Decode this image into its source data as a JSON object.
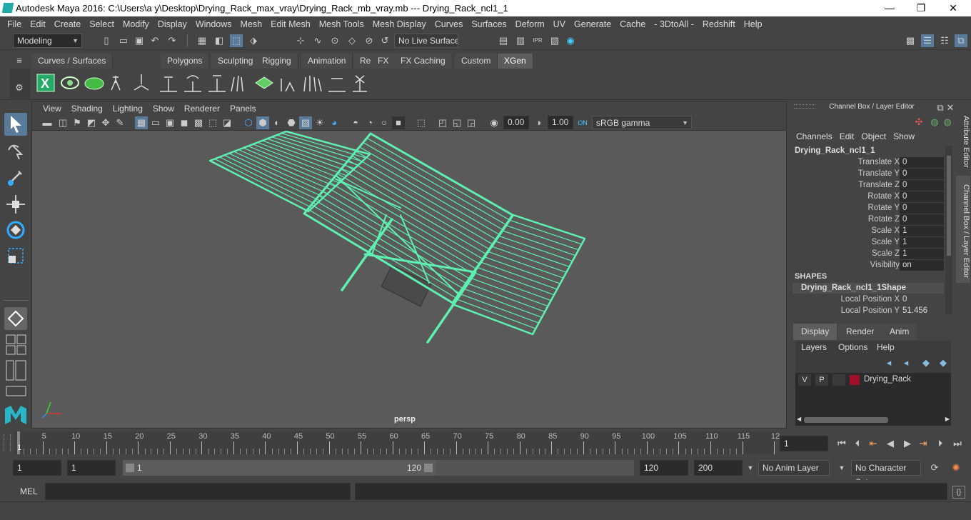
{
  "window": {
    "title": "Autodesk Maya 2016: C:\\Users\\a y\\Desktop\\Drying_Rack_max_vray\\Drying_Rack_mb_vray.mb   ---   Drying_Rack_ncl1_1"
  },
  "menubar": [
    "File",
    "Edit",
    "Create",
    "Select",
    "Modify",
    "Display",
    "Windows",
    "Mesh",
    "Edit Mesh",
    "Mesh Tools",
    "Mesh Display",
    "Curves",
    "Surfaces",
    "Deform",
    "UV",
    "Generate",
    "Cache",
    "- 3DtoAll -",
    "Redshift",
    "Help"
  ],
  "statusline": {
    "mode": "Modeling",
    "live_surface": "No Live Surface"
  },
  "shelf_tabs": [
    "Curves / Surfaces",
    "Polygons",
    "Sculpting",
    "Rigging",
    "Animation",
    "Rendering",
    "FX",
    "FX Caching",
    "Custom",
    "XGen"
  ],
  "active_shelf_tab": "XGen",
  "viewport": {
    "menu": [
      "View",
      "Shading",
      "Lighting",
      "Show",
      "Renderer",
      "Panels"
    ],
    "exposure": "0.00",
    "gamma": "1.00",
    "colorspace": "sRGB gamma",
    "camera_label": "persp",
    "wire_color": "#5ef0b0"
  },
  "channel_box": {
    "title": "Channel Box / Layer Editor",
    "menu": [
      "Channels",
      "Edit",
      "Object",
      "Show"
    ],
    "object_name": "Drying_Rack_ncl1_1",
    "attributes": [
      {
        "label": "Translate X",
        "value": "0"
      },
      {
        "label": "Translate Y",
        "value": "0"
      },
      {
        "label": "Translate Z",
        "value": "0"
      },
      {
        "label": "Rotate X",
        "value": "0"
      },
      {
        "label": "Rotate Y",
        "value": "0"
      },
      {
        "label": "Rotate Z",
        "value": "0"
      },
      {
        "label": "Scale X",
        "value": "1"
      },
      {
        "label": "Scale Y",
        "value": "1"
      },
      {
        "label": "Scale Z",
        "value": "1"
      },
      {
        "label": "Visibility",
        "value": "on"
      }
    ],
    "shapes_header": "SHAPES",
    "shape_name": "Drying_Rack_ncl1_1Shape",
    "shape_attributes": [
      {
        "label": "Local Position X",
        "value": "0"
      },
      {
        "label": "Local Position Y",
        "value": "51.456"
      }
    ]
  },
  "side_tabs": [
    "Attribute Editor",
    "Channel Box / Layer Editor"
  ],
  "layer_editor": {
    "tabs": [
      "Display",
      "Render",
      "Anim"
    ],
    "active_tab": "Display",
    "menu": [
      "Layers",
      "Options",
      "Help"
    ],
    "layers": [
      {
        "v": "V",
        "p": "P",
        "name": "Drying_Rack",
        "color": "#a0102a"
      }
    ]
  },
  "timeline": {
    "ticks": [
      "5",
      "10",
      "15",
      "20",
      "25",
      "30",
      "35",
      "40",
      "45",
      "50",
      "55",
      "60",
      "65",
      "70",
      "75",
      "80",
      "85",
      "90",
      "95",
      "100",
      "105",
      "110",
      "115",
      "12"
    ],
    "start_marker": "1",
    "current_frame": "1"
  },
  "range": {
    "start": "1",
    "anim_start": "1",
    "slider_start": "1",
    "slider_end": "120",
    "end": "120",
    "anim_end": "200",
    "anim_layer": "No Anim Layer",
    "character_set": "No Character Set"
  },
  "command_line": {
    "label": "MEL"
  }
}
